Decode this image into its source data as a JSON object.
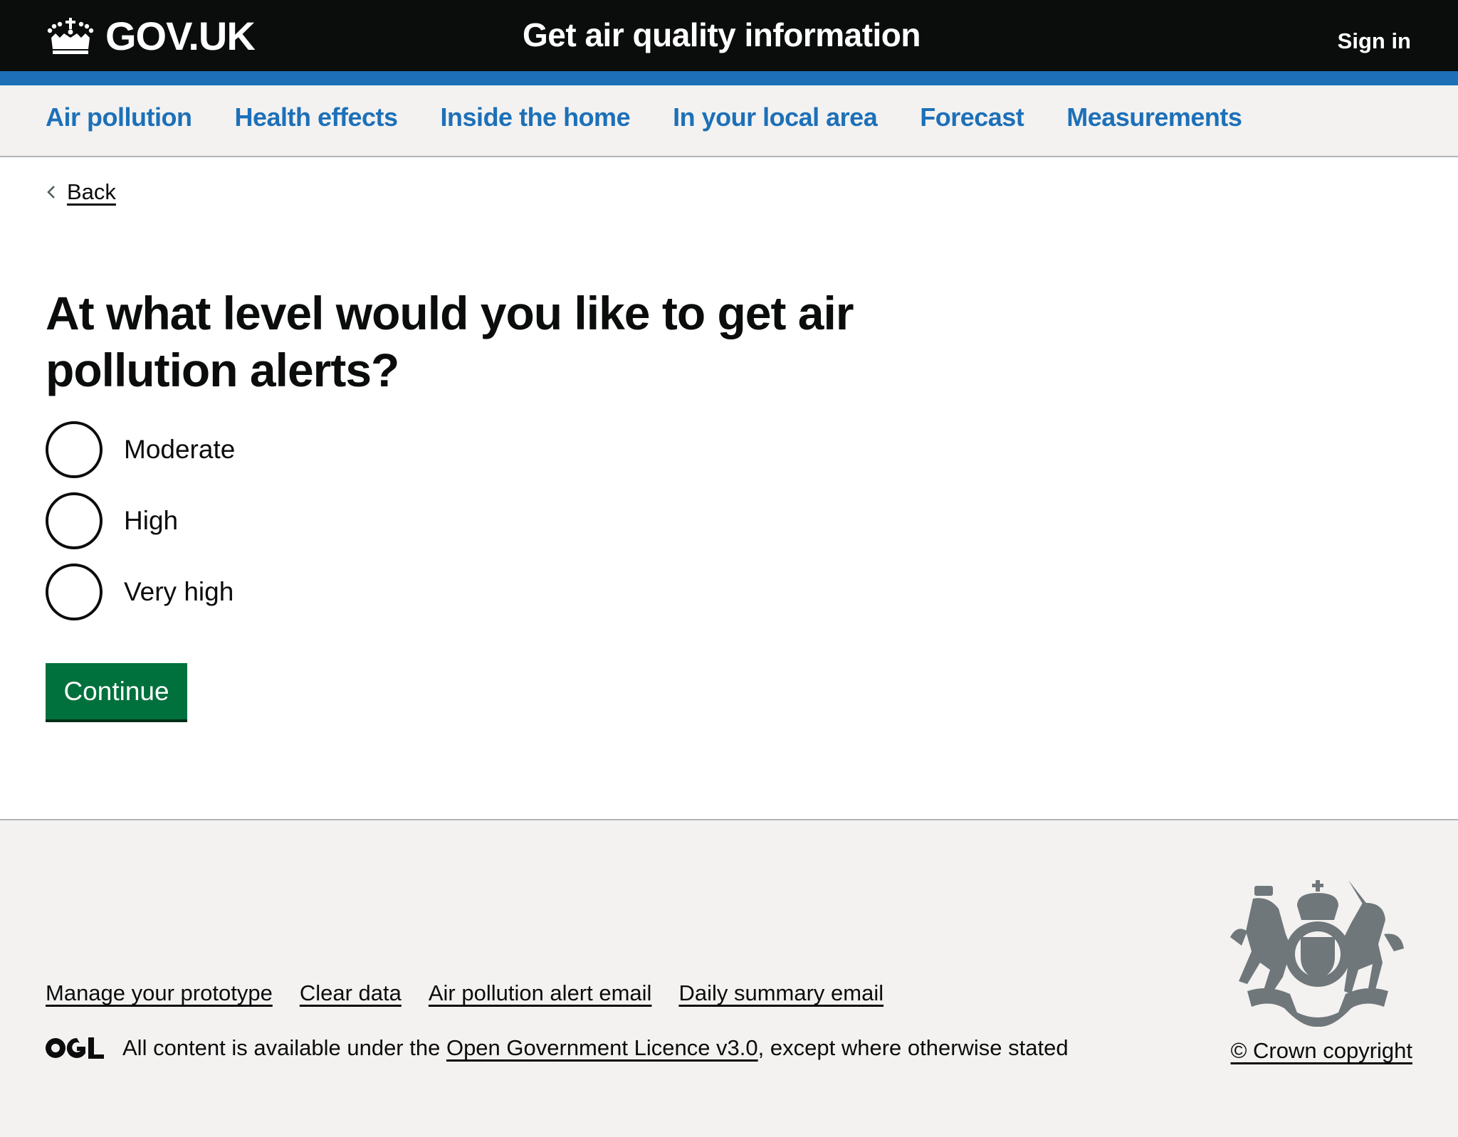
{
  "header": {
    "logo_text": "GOV.UK",
    "service_name": "Get air quality information",
    "sign_in_label": "Sign in"
  },
  "nav": {
    "items": [
      {
        "label": "Air pollution"
      },
      {
        "label": "Health effects"
      },
      {
        "label": "Inside the home"
      },
      {
        "label": "In your local area"
      },
      {
        "label": "Forecast"
      },
      {
        "label": "Measurements"
      }
    ]
  },
  "back_link": {
    "label": "Back"
  },
  "question": {
    "heading": "At what level would you like to get air pollution alerts?",
    "options": [
      {
        "label": "Moderate",
        "checked": false
      },
      {
        "label": "High",
        "checked": false
      },
      {
        "label": "Very high",
        "checked": false
      }
    ]
  },
  "continue_label": "Continue",
  "footer": {
    "links": [
      {
        "label": "Manage your prototype"
      },
      {
        "label": "Clear data"
      },
      {
        "label": "Air pollution alert email"
      },
      {
        "label": "Daily summary email"
      }
    ],
    "licence_prefix": "All content is available under the ",
    "licence_link": "Open Government Licence v3.0",
    "licence_suffix": ", except where otherwise stated",
    "copyright": "© Crown copyright"
  },
  "colors": {
    "header_bg": "#0b0c0c",
    "brand_blue": "#1d70b8",
    "button_green": "#00703c",
    "footer_bg": "#f3f2f1",
    "crest_grey": "#6f777b"
  }
}
